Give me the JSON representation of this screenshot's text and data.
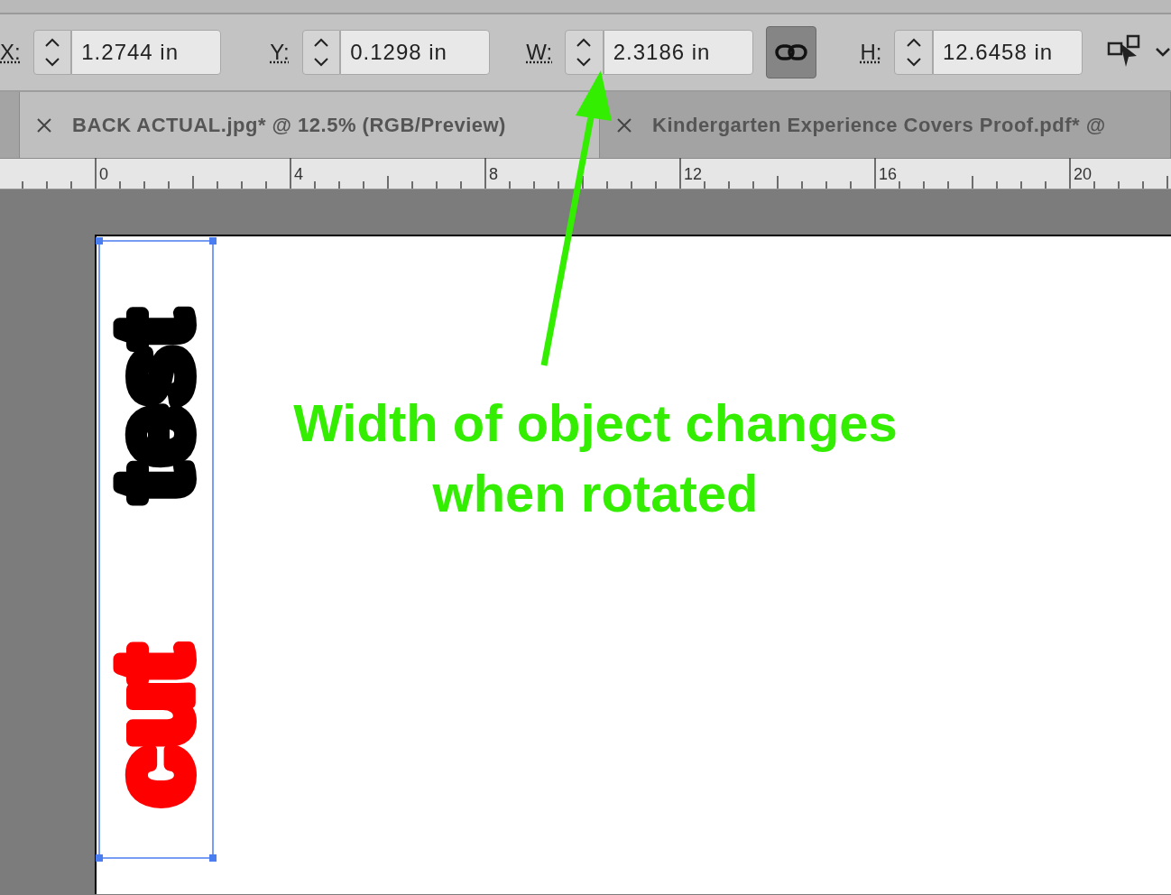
{
  "fields": [
    {
      "label": "X:",
      "value": "1.2744 in"
    },
    {
      "label": "Y:",
      "value": "0.1298 in"
    },
    {
      "label": "W:",
      "value": "2.3186 in"
    },
    {
      "label": "H:",
      "value": "12.6458 in"
    }
  ],
  "constrain_link": {
    "selected": true
  },
  "tabs": [
    {
      "label": "BACK ACTUAL.jpg* @ 12.5% (RGB/Preview)",
      "selected": true
    },
    {
      "label": "Kindergarten Experience Covers Proof.pdf* @",
      "selected": false
    }
  ],
  "ruler_labels": [
    "0",
    "4",
    "8",
    "12",
    "16",
    "20"
  ],
  "artwork": [
    {
      "text": "test",
      "color": "#000000"
    },
    {
      "text": "cut",
      "color": "#ff0000"
    }
  ],
  "annotation": "Width of object changes when rotated"
}
